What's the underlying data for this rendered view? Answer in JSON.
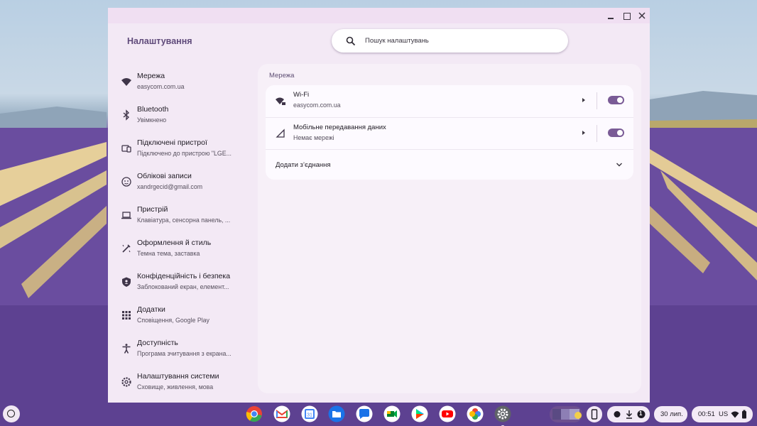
{
  "app": {
    "title": "Налаштування"
  },
  "search": {
    "placeholder": "Пошук налаштувань"
  },
  "sidebar": {
    "items": [
      {
        "label": "Мережа",
        "sub": "easycom.com.ua",
        "icon": "wifi-icon"
      },
      {
        "label": "Bluetooth",
        "sub": "Увімкнено",
        "icon": "bluetooth-icon"
      },
      {
        "label": "Підключені пристрої",
        "sub": "Підключено до пристрою \"LGE...",
        "icon": "connected-devices-icon"
      },
      {
        "label": "Облікові записи",
        "sub": "xandrgecid@gmail.com",
        "icon": "account-icon"
      },
      {
        "label": "Пристрій",
        "sub": "Клавіатура, сенсорна панель, ...",
        "icon": "laptop-icon"
      },
      {
        "label": "Оформлення й стиль",
        "sub": "Темна тема, заставка",
        "icon": "brush-icon"
      },
      {
        "label": "Конфіденційність і безпека",
        "sub": "Заблокований екран, елемент...",
        "icon": "shield-icon"
      },
      {
        "label": "Додатки",
        "sub": "Сповіщення, Google Play",
        "icon": "apps-grid-icon"
      },
      {
        "label": "Доступність",
        "sub": "Програма зчитування з екрана...",
        "icon": "accessibility-icon"
      },
      {
        "label": "Налаштування системи",
        "sub": "Сховище, живлення, мова",
        "icon": "system-gear-icon"
      }
    ]
  },
  "main": {
    "section_title": "Мережа",
    "rows": [
      {
        "label": "Wi-Fi",
        "sub": "easycom.com.ua",
        "icon": "wifi-locked-icon",
        "toggle_on": true
      },
      {
        "label": "Мобільне передавання даних",
        "sub": "Немає мережі",
        "icon": "cellular-signal-icon",
        "toggle_on": true
      }
    ],
    "add_connection": "Додати з’єднання"
  },
  "shelf": {
    "apps": [
      "chrome-icon",
      "gmail-icon",
      "calendar-icon",
      "files-icon",
      "messages-icon",
      "meet-icon",
      "play-store-icon",
      "youtube-icon",
      "photos-icon",
      "settings-icon"
    ],
    "notification_count": "1",
    "date": "30 лип.",
    "time": "00:51",
    "keyboard_layout": "US"
  },
  "colors": {
    "accent": "#7a5b96",
    "window_bg": "#f3e9f5",
    "panel_bg": "#f7f0f8"
  }
}
